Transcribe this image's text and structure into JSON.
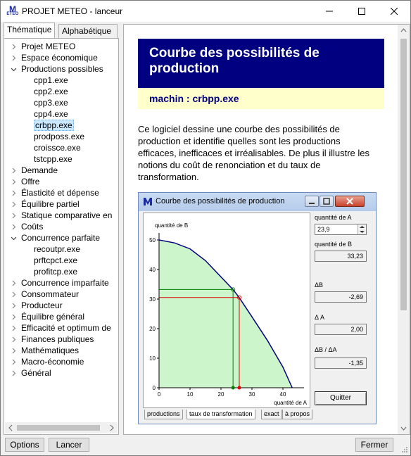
{
  "window": {
    "title": "PROJET METEO - lanceur",
    "icon_letter": "M",
    "icon_sub": "ETEO"
  },
  "tabs": {
    "thematic": "Thématique",
    "alphabetic": "Alphabétique"
  },
  "tree": [
    {
      "label": "Projet METEO",
      "caret": "right",
      "indent": 0
    },
    {
      "label": "Espace économique",
      "caret": "right",
      "indent": 0
    },
    {
      "label": "Productions possibles",
      "caret": "down",
      "indent": 0
    },
    {
      "label": "cpp1.exe",
      "caret": "",
      "indent": 1
    },
    {
      "label": "cpp2.exe",
      "caret": "",
      "indent": 1
    },
    {
      "label": "cpp3.exe",
      "caret": "",
      "indent": 1
    },
    {
      "label": "cpp4.exe",
      "caret": "",
      "indent": 1
    },
    {
      "label": "crbpp.exe",
      "caret": "",
      "indent": 1,
      "selected": true
    },
    {
      "label": "prodposs.exe",
      "caret": "",
      "indent": 1
    },
    {
      "label": "croissce.exe",
      "caret": "",
      "indent": 1
    },
    {
      "label": "tstcpp.exe",
      "caret": "",
      "indent": 1
    },
    {
      "label": "Demande",
      "caret": "right",
      "indent": 0
    },
    {
      "label": "Offre",
      "caret": "right",
      "indent": 0
    },
    {
      "label": "Élasticité et dépense",
      "caret": "right",
      "indent": 0
    },
    {
      "label": "Équilibre partiel",
      "caret": "right",
      "indent": 0
    },
    {
      "label": "Statique comparative en",
      "caret": "right",
      "indent": 0
    },
    {
      "label": "Coûts",
      "caret": "right",
      "indent": 0
    },
    {
      "label": "Concurrence parfaite",
      "caret": "down",
      "indent": 0
    },
    {
      "label": "recoutpr.exe",
      "caret": "",
      "indent": 1
    },
    {
      "label": "prftcpct.exe",
      "caret": "",
      "indent": 1
    },
    {
      "label": "profitcp.exe",
      "caret": "",
      "indent": 1
    },
    {
      "label": "Concurrence imparfaite",
      "caret": "right",
      "indent": 0
    },
    {
      "label": "Consommateur",
      "caret": "right",
      "indent": 0
    },
    {
      "label": "Producteur",
      "caret": "right",
      "indent": 0
    },
    {
      "label": "Équilibre général",
      "caret": "right",
      "indent": 0
    },
    {
      "label": "Efficacité et optimum de",
      "caret": "right",
      "indent": 0
    },
    {
      "label": "Finances publiques",
      "caret": "right",
      "indent": 0
    },
    {
      "label": "Mathématiques",
      "caret": "right",
      "indent": 0
    },
    {
      "label": "Macro-économie",
      "caret": "right",
      "indent": 0
    },
    {
      "label": "Général",
      "caret": "right",
      "indent": 0
    }
  ],
  "doc": {
    "title": "Courbe des possibilités de production",
    "subtitle": "machin : crbpp.exe",
    "body": "Ce logiciel dessine une courbe des possibilités de production et identifie quelles sont les productions efficaces, inefficaces et irréalisables. De plus il illustre les notions du coût de renonciation et du taux de transformation."
  },
  "inner": {
    "title": "Courbe des possibilités de production",
    "qa_label": "quantité de A",
    "qa_value": "23,9",
    "qb_label": "quantité de B",
    "qb_value": "33,23",
    "db_label": "ΔB",
    "db_value": "-2,69",
    "da_label": "Δ A",
    "da_value": "2,00",
    "ratio_label": "ΔB  / ΔA",
    "ratio_value": "-1,35",
    "quit_label": "Quitter",
    "tabs": [
      "productions",
      "taux de transformation",
      "exact",
      "à propos"
    ]
  },
  "chart_data": {
    "type": "line",
    "title": "",
    "xlabel": "quantité de A",
    "ylabel": "quantité de B",
    "xlim": [
      0,
      45
    ],
    "ylim": [
      0,
      50
    ],
    "xticks": [
      0,
      10,
      20,
      30,
      40
    ],
    "yticks": [
      0,
      10,
      20,
      30,
      40,
      50
    ],
    "series": [
      {
        "x": [
          0,
          5,
          10,
          15,
          20,
          23.9,
          25.9,
          30,
          35,
          40,
          43
        ],
        "y": [
          50,
          49,
          47,
          43,
          37.5,
          33.23,
          30.5,
          24,
          16,
          7,
          0
        ]
      }
    ],
    "points": [
      {
        "x": 23.9,
        "y": 33.23
      },
      {
        "x": 25.9,
        "y": 30.54
      }
    ],
    "colors": {
      "curve": "#000080",
      "fill": "#ccf5cc",
      "green": "#008000",
      "red": "#e00000"
    }
  },
  "buttons": {
    "options": "Options",
    "launch": "Lancer",
    "close": "Fermer"
  }
}
